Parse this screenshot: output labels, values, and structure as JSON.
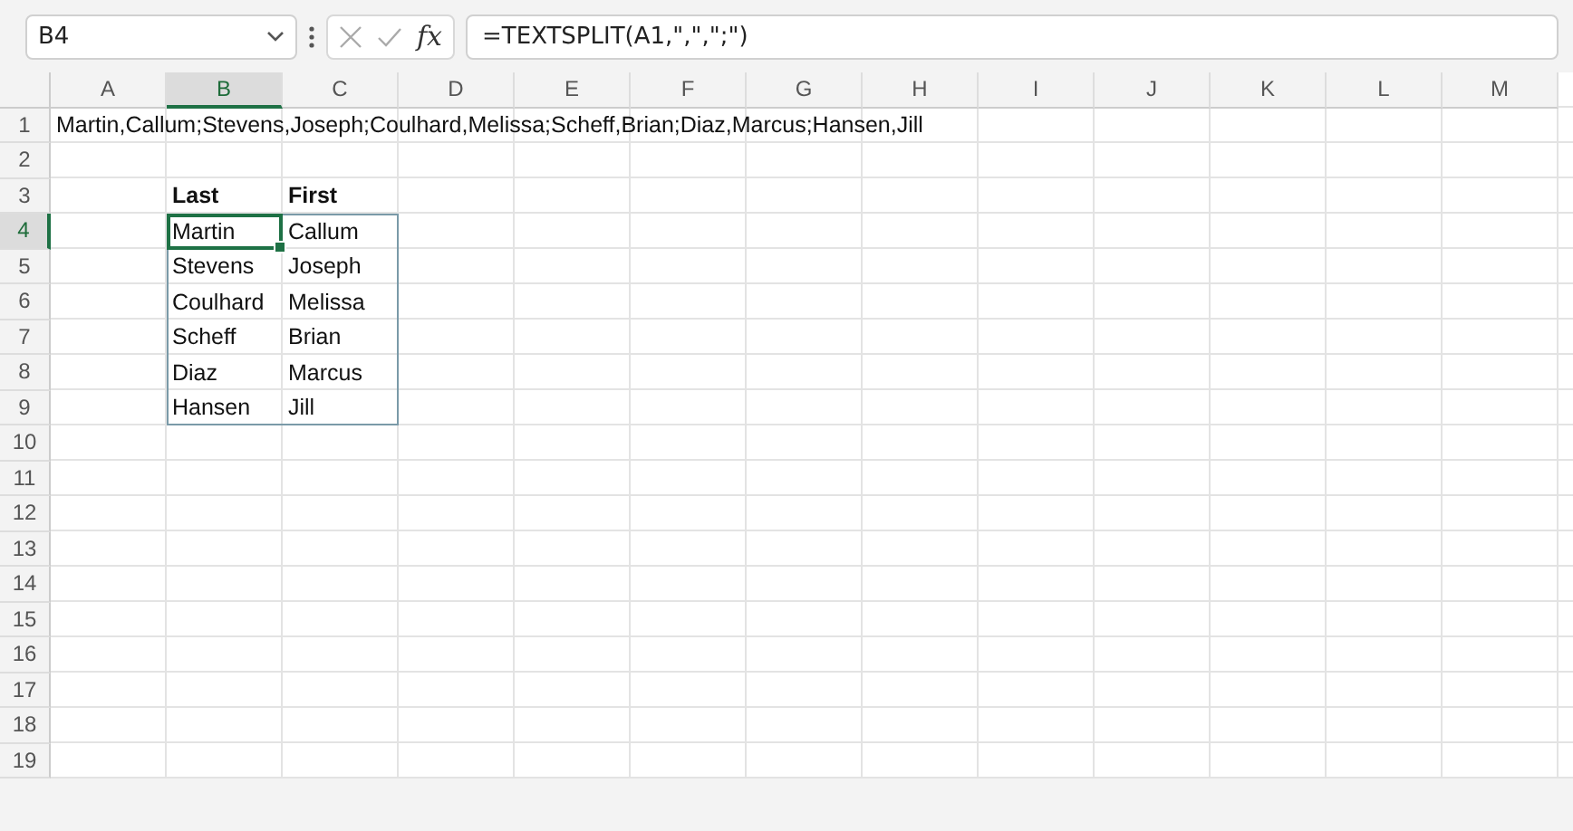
{
  "name_box": {
    "value": "B4"
  },
  "formula_bar": {
    "fx": "fx",
    "value": "=TEXTSPLIT(A1,\",\",\";\")"
  },
  "columns": [
    {
      "label": "A",
      "selected": false
    },
    {
      "label": "B",
      "selected": true
    },
    {
      "label": "C",
      "selected": false
    },
    {
      "label": "D",
      "selected": false
    },
    {
      "label": "E",
      "selected": false
    },
    {
      "label": "F",
      "selected": false
    },
    {
      "label": "G",
      "selected": false
    },
    {
      "label": "H",
      "selected": false
    },
    {
      "label": "I",
      "selected": false
    },
    {
      "label": "J",
      "selected": false
    },
    {
      "label": "K",
      "selected": false
    },
    {
      "label": "L",
      "selected": false
    },
    {
      "label": "M",
      "selected": false
    }
  ],
  "rows": [
    {
      "label": "1",
      "selected": false,
      "cells": [
        {
          "kind": "text",
          "text": "Martin,Callum;Stevens,Joseph;Coulhard,Melissa;Scheff,Brian;Diaz,Marcus;Hansen,Jill"
        }
      ]
    },
    {
      "label": "2",
      "selected": false,
      "cells": []
    },
    {
      "label": "3",
      "selected": false,
      "cells": [
        {
          "kind": "empty"
        },
        {
          "kind": "header",
          "text": "Last"
        },
        {
          "kind": "header",
          "text": "First"
        }
      ]
    },
    {
      "label": "4",
      "selected": true,
      "cells": [
        {
          "kind": "empty"
        },
        {
          "kind": "spill",
          "text": "Martin"
        },
        {
          "kind": "spill",
          "text": "Callum"
        }
      ]
    },
    {
      "label": "5",
      "selected": false,
      "cells": [
        {
          "kind": "empty"
        },
        {
          "kind": "spill",
          "text": "Stevens"
        },
        {
          "kind": "spill",
          "text": "Joseph"
        }
      ]
    },
    {
      "label": "6",
      "selected": false,
      "cells": [
        {
          "kind": "empty"
        },
        {
          "kind": "spill",
          "text": "Coulhard"
        },
        {
          "kind": "spill",
          "text": "Melissa"
        }
      ]
    },
    {
      "label": "7",
      "selected": false,
      "cells": [
        {
          "kind": "empty"
        },
        {
          "kind": "spill",
          "text": "Scheff"
        },
        {
          "kind": "spill",
          "text": "Brian"
        }
      ]
    },
    {
      "label": "8",
      "selected": false,
      "cells": [
        {
          "kind": "empty"
        },
        {
          "kind": "spill",
          "text": "Diaz"
        },
        {
          "kind": "spill",
          "text": "Marcus"
        }
      ]
    },
    {
      "label": "9",
      "selected": false,
      "cells": [
        {
          "kind": "empty"
        },
        {
          "kind": "spill",
          "text": "Hansen"
        },
        {
          "kind": "spill",
          "text": "Jill"
        }
      ]
    },
    {
      "label": "10",
      "selected": false,
      "cells": []
    },
    {
      "label": "11",
      "selected": false,
      "cells": []
    },
    {
      "label": "12",
      "selected": false,
      "cells": []
    },
    {
      "label": "13",
      "selected": false,
      "cells": []
    },
    {
      "label": "14",
      "selected": false,
      "cells": []
    },
    {
      "label": "15",
      "selected": false,
      "cells": []
    },
    {
      "label": "16",
      "selected": false,
      "cells": []
    },
    {
      "label": "17",
      "selected": false,
      "cells": []
    },
    {
      "label": "18",
      "selected": false,
      "cells": []
    },
    {
      "label": "19",
      "selected": false,
      "cells": []
    }
  ]
}
